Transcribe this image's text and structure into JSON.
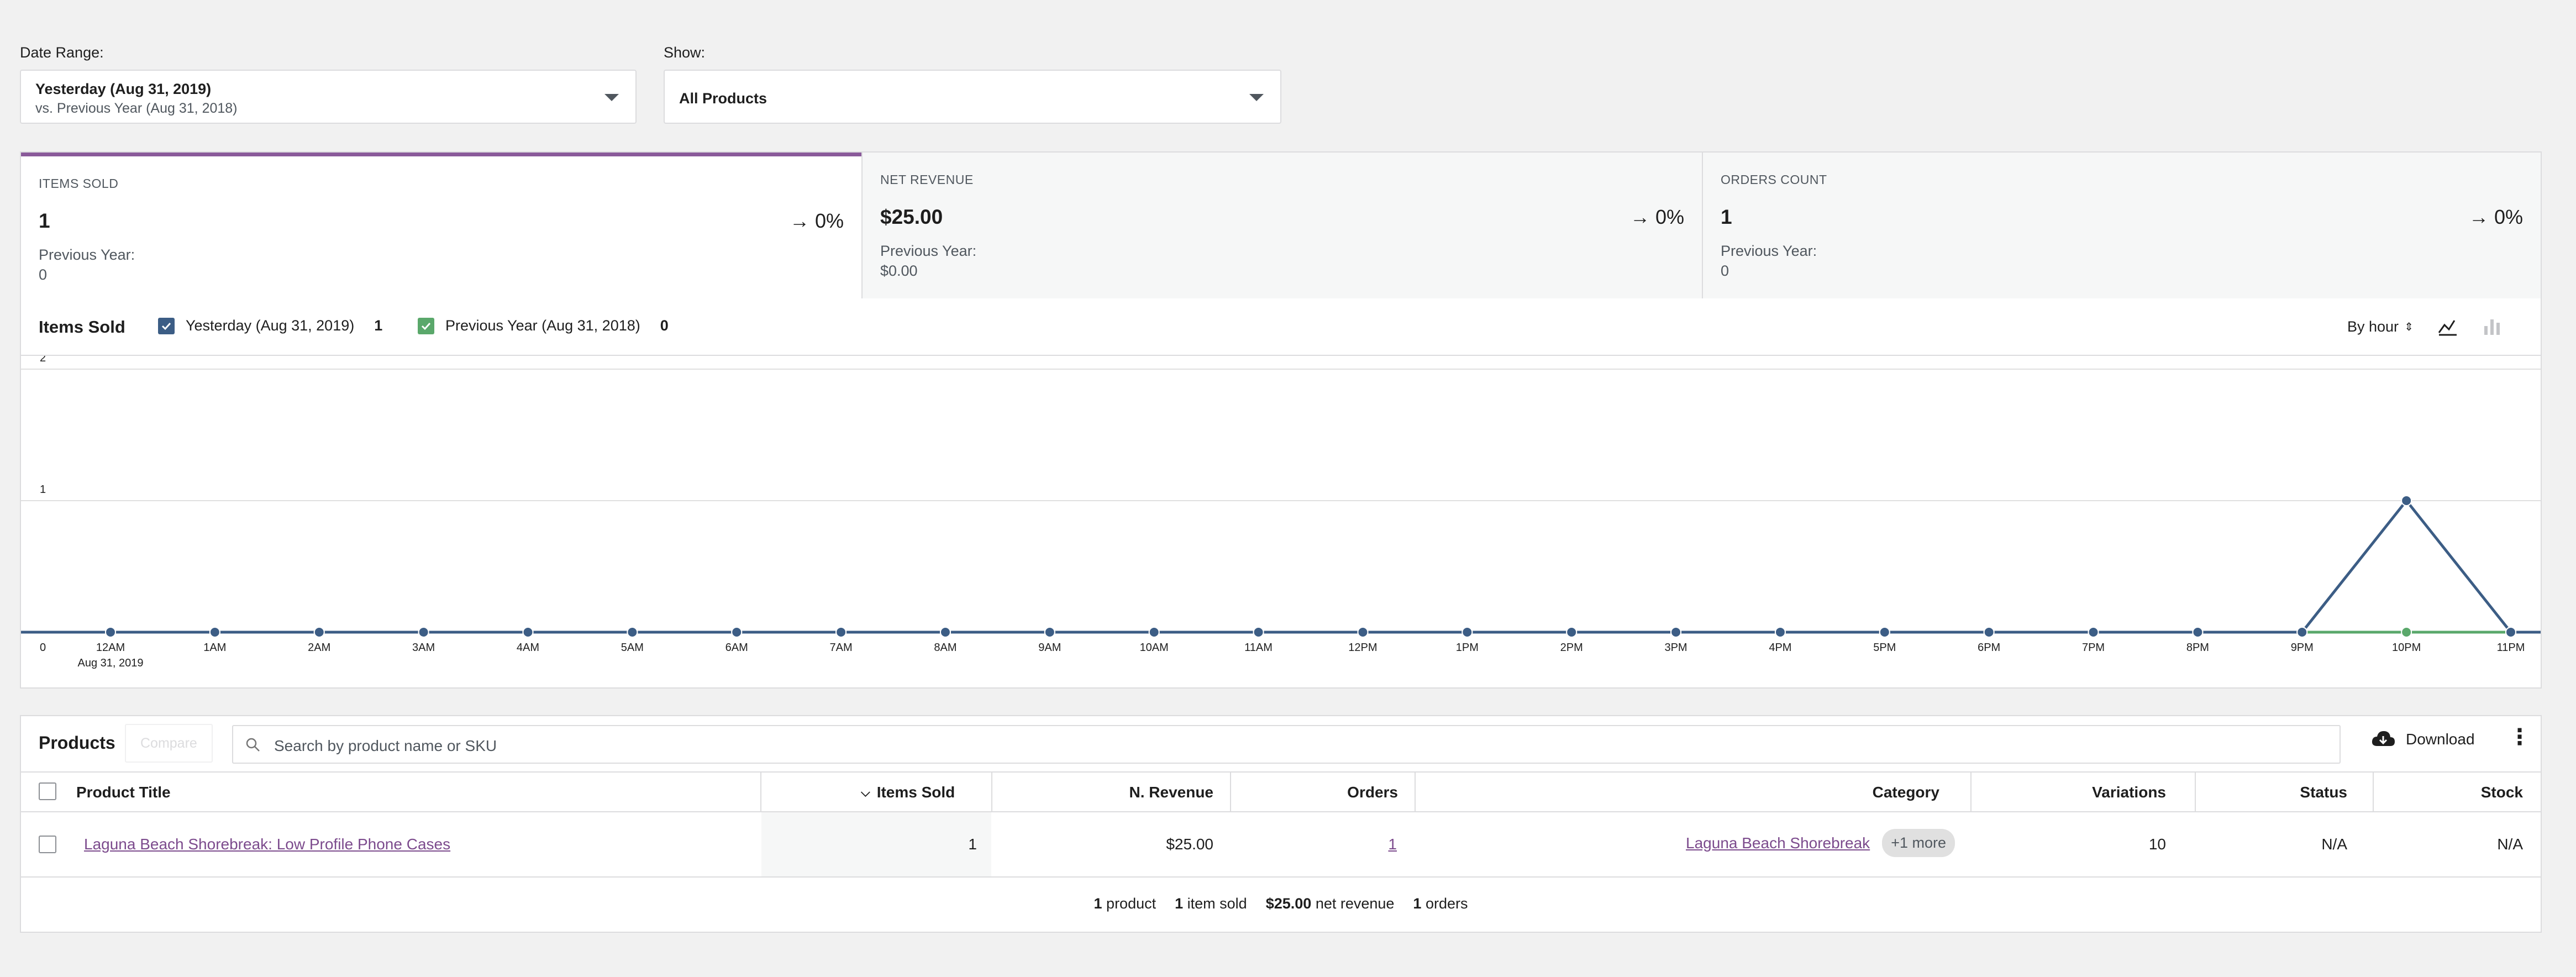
{
  "filters": {
    "date_range": {
      "label": "Date Range:",
      "value": "Yesterday (Aug 31, 2019)",
      "compare": "vs. Previous Year (Aug 31, 2018)"
    },
    "show": {
      "label": "Show:",
      "value": "All Products"
    }
  },
  "summary": [
    {
      "label": "ITEMS SOLD",
      "value": "1",
      "delta": "0%",
      "prev_label": "Previous Year:",
      "prev_value": "0"
    },
    {
      "label": "NET REVENUE",
      "value": "$25.00",
      "delta": "0%",
      "prev_label": "Previous Year:",
      "prev_value": "$0.00"
    },
    {
      "label": "ORDERS COUNT",
      "value": "1",
      "delta": "0%",
      "prev_label": "Previous Year:",
      "prev_value": "0"
    }
  ],
  "chart_header": {
    "title": "Items Sold",
    "legend": [
      {
        "label": "Yesterday (Aug 31, 2019)",
        "value": "1",
        "color": "#3c5d85"
      },
      {
        "label": "Previous Year (Aug 31, 2018)",
        "value": "0",
        "color": "#5aa86b"
      }
    ],
    "interval": "By hour"
  },
  "chart_data": {
    "type": "line",
    "x": [
      "12AM",
      "1AM",
      "2AM",
      "3AM",
      "4AM",
      "5AM",
      "6AM",
      "7AM",
      "8AM",
      "9AM",
      "10AM",
      "11AM",
      "12PM",
      "1PM",
      "2PM",
      "3PM",
      "4PM",
      "5PM",
      "6PM",
      "7PM",
      "8PM",
      "9PM",
      "10PM",
      "11PM"
    ],
    "x_sublabel": "Aug 31, 2019",
    "series": [
      {
        "name": "Yesterday (Aug 31, 2019)",
        "color": "#3c5d85",
        "values": [
          0,
          0,
          0,
          0,
          0,
          0,
          0,
          0,
          0,
          0,
          0,
          0,
          0,
          0,
          0,
          0,
          0,
          0,
          0,
          0,
          0,
          0,
          1,
          0
        ]
      },
      {
        "name": "Previous Year (Aug 31, 2018)",
        "color": "#5aa86b",
        "values": [
          0,
          0,
          0,
          0,
          0,
          0,
          0,
          0,
          0,
          0,
          0,
          0,
          0,
          0,
          0,
          0,
          0,
          0,
          0,
          0,
          0,
          0,
          0,
          0
        ]
      }
    ],
    "y_ticks": [
      "0",
      "1",
      "2"
    ],
    "ylim": [
      0,
      2
    ],
    "grid": true
  },
  "products": {
    "title": "Products",
    "compare_label": "Compare",
    "search_placeholder": "Search by product name or SKU",
    "download_label": "Download",
    "columns": [
      "Product Title",
      "Items Sold",
      "N. Revenue",
      "Orders",
      "Category",
      "Variations",
      "Status",
      "Stock"
    ],
    "rows": [
      {
        "title": "Laguna Beach Shorebreak: Low Profile Phone Cases",
        "items_sold": "1",
        "revenue": "$25.00",
        "orders": "1",
        "category": "Laguna Beach Shorebreak",
        "category_more": "+1 more",
        "variations": "10",
        "status": "N/A",
        "stock": "N/A"
      }
    ],
    "footer": {
      "products_count": "1",
      "products_label": "product",
      "items_count": "1",
      "items_label": "item sold",
      "revenue": "$25.00",
      "revenue_label": "net revenue",
      "orders_count": "1",
      "orders_label": "orders"
    }
  }
}
